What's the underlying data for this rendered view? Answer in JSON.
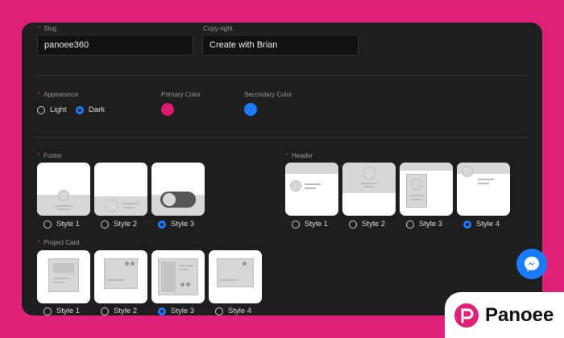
{
  "form": {
    "slug": {
      "label": "Slug",
      "value": "panoee360"
    },
    "copyright": {
      "label": "Copy-right",
      "value": "Create with Brian"
    },
    "appearance": {
      "label": "Appearance",
      "options": [
        "Light",
        "Dark"
      ],
      "selected": "Dark"
    },
    "primary_color": {
      "label": "Primary Color",
      "value": "#e0196d"
    },
    "secondary_color": {
      "label": "Secondary Color",
      "value": "#1a7bff"
    },
    "footer": {
      "label": "Footer",
      "options": [
        "Style 1",
        "Style 2",
        "Style 3"
      ],
      "selected": "Style 3"
    },
    "header": {
      "label": "Header",
      "options": [
        "Style 1",
        "Style 2",
        "Style 3",
        "Style 4"
      ],
      "selected": "Style 4"
    },
    "project_card": {
      "label": "Project Card",
      "options": [
        "Style 1",
        "Style 2",
        "Style 3",
        "Style 4"
      ],
      "selected": "Style 3"
    }
  },
  "required_marker": "*",
  "brand": {
    "name": "Panoee",
    "accent": "#e0217a"
  },
  "icons": {
    "chat": "messenger-icon",
    "logo": "panoee-logo-icon"
  }
}
